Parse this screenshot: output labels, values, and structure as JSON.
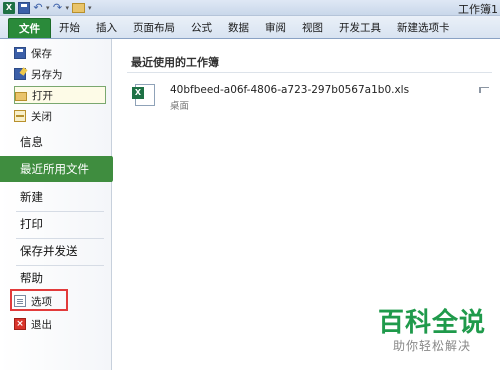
{
  "window": {
    "title": "工作簿1"
  },
  "ribbon": {
    "tabs": [
      "文件",
      "开始",
      "插入",
      "页面布局",
      "公式",
      "数据",
      "审阅",
      "视图",
      "开发工具",
      "新建选项卡"
    ]
  },
  "backstage": {
    "small_items": [
      "保存",
      "另存为",
      "打开",
      "关闭"
    ],
    "info": "信息",
    "recent": "最近所用文件",
    "new": "新建",
    "print": "打印",
    "save_send": "保存并发送",
    "help": "帮助",
    "options": "选项",
    "exit": "退出"
  },
  "recent_pane": {
    "title": "最近使用的工作簿",
    "files": [
      {
        "name": "40bfbeed-a06f-4806-a723-297b0567a1b0.xls",
        "location": "桌面"
      }
    ]
  },
  "watermark": {
    "main": "百科全说",
    "sub": "助你轻松解决"
  },
  "colors": {
    "file_tab": "#2a8a3a",
    "active_nav": "#3f8d3f",
    "highlight_box": "#e23b3b"
  }
}
